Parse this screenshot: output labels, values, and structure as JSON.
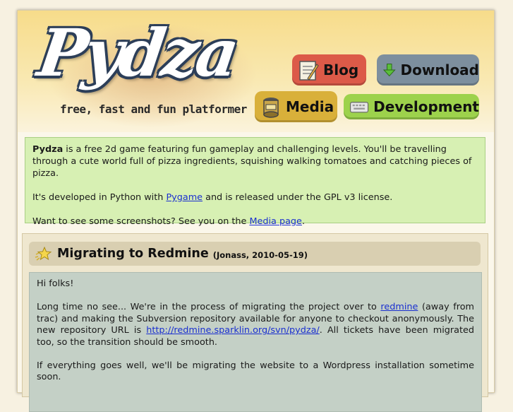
{
  "header": {
    "logo": "Pydza",
    "tagline": "free, fast and fun platformer"
  },
  "nav": {
    "blog": "Blog",
    "download": "Download",
    "media": "Media",
    "development": "Development"
  },
  "intro": {
    "p1_bold": "Pydza",
    "p1_rest": " is a free 2d game featuring fun gameplay and challenging levels. You'll be travelling through a cute world full of pizza ingredients, squishing walking tomatoes and catching pieces of pizza.",
    "p2_before": "It's developed in Python with ",
    "p2_link": "Pygame",
    "p2_after": " and is released under the GPL v3 license.",
    "p3_before": "Want to see some screenshots? See you on the ",
    "p3_link": "Media page",
    "p3_after": "."
  },
  "post": {
    "title": "Migrating to Redmine",
    "meta": "(Jonass, 2010-05-19)",
    "greeting": "Hi folks!",
    "p2_before": "Long time no see... We're in the process of migrating the project over to ",
    "p2_link1": "redmine",
    "p2_mid": " (away from trac) and making the Subversion repository available for anyone to checkout anonymously. The new repository URL is ",
    "p2_link2": "http://redmine.sparklin.org/svn/pydza/",
    "p2_after": ". All tickets have been migrated too, so the transition should be smooth.",
    "p3": "If everything goes well, we'll be migrating the website to a Wordpress installation sometime soon."
  },
  "icons": {
    "blog": "notepad-icon",
    "download": "down-arrow-icon",
    "media": "film-reel-icon",
    "development": "keyboard-icon",
    "post": "star-icon"
  }
}
